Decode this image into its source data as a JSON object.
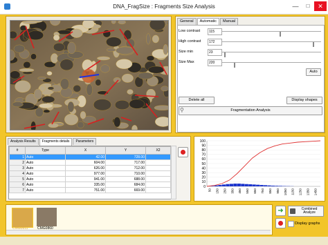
{
  "window": {
    "title": "DNA_FragSize : Fragments Size Analysis"
  },
  "controls": {
    "tabs": [
      "General",
      "Automatic",
      "Manual"
    ],
    "active_tab": "Automatic",
    "params": [
      {
        "label": "Low contrast",
        "value": "115",
        "fraction": 0.59
      },
      {
        "label": "High contrast",
        "value": "172",
        "fraction": 0.93
      },
      {
        "label": "Size min",
        "value": "23",
        "fraction": 0.02
      },
      {
        "label": "Size Max",
        "value": "220",
        "fraction": 0.12
      }
    ],
    "auto_label": "Auto",
    "delete_all_label": "Delete all",
    "display_shapes_label": "Display shapes",
    "fragmentation_label": "Fragmentation Analysis"
  },
  "results": {
    "tabs": [
      "Analysis Results",
      "Fragments details",
      "Parameters"
    ],
    "active_tab": "Fragments details",
    "columns": [
      "#",
      "Type",
      "X",
      "Y",
      "X2"
    ],
    "rows": [
      {
        "idx": "1",
        "type": "Auto",
        "x": "42.00",
        "y": "728.00",
        "selected": true
      },
      {
        "idx": "2",
        "type": "Auto",
        "x": "604.00",
        "y": "717.00",
        "selected": false
      },
      {
        "idx": "3",
        "type": "Auto",
        "x": "626.00",
        "y": "712.00",
        "selected": false
      },
      {
        "idx": "4",
        "type": "Auto",
        "x": "977.00",
        "y": "710.00",
        "selected": false
      },
      {
        "idx": "5",
        "type": "Auto",
        "x": "941.00",
        "y": "688.00",
        "selected": false
      },
      {
        "idx": "6",
        "type": "Auto",
        "x": "335.00",
        "y": "684.00",
        "selected": false
      },
      {
        "idx": "7",
        "type": "Auto",
        "x": "751.00",
        "y": "669.00",
        "selected": false
      }
    ]
  },
  "chart_data": {
    "type": "line",
    "y_ticks": [
      "100",
      "90",
      "80",
      "70",
      "60",
      "50",
      "40",
      "30",
      "20",
      "10",
      "0"
    ],
    "x_ticks": [
      "50",
      "150",
      "250",
      "350",
      "450",
      "550",
      "650",
      "750",
      "850",
      "950",
      "1050",
      "1150",
      "1250",
      "1350",
      "1450"
    ],
    "ylim": [
      0,
      100
    ],
    "xlim": [
      0,
      1500
    ],
    "series": [
      {
        "type": "line",
        "color": "#e03030",
        "x": [
          0,
          100,
          200,
          300,
          400,
          500,
          600,
          700,
          800,
          900,
          1000,
          1100,
          1200,
          1300,
          1400,
          1500
        ],
        "y": [
          0,
          2,
          6,
          14,
          28,
          45,
          62,
          74,
          83,
          89,
          93,
          95,
          97,
          98,
          99,
          100
        ]
      },
      {
        "type": "bar",
        "color": "#1a33cc",
        "x": [
          0,
          50,
          100,
          150,
          200,
          250,
          300,
          350,
          400,
          450,
          500,
          550,
          600,
          650,
          700,
          750,
          800,
          850,
          900,
          950,
          1000,
          1050,
          1100
        ],
        "y": [
          0.5,
          1,
          2,
          3,
          4,
          5,
          5.5,
          6,
          6,
          5.5,
          5,
          4.5,
          4,
          3.5,
          3,
          2.5,
          2,
          1.5,
          1.2,
          1,
          0.7,
          0.5,
          0.3
        ]
      }
    ]
  },
  "thumbnails": [
    {
      "caption": "CMG0811"
    },
    {
      "caption": "CMG0860"
    }
  ],
  "combined_analyze_label": "Combined Analyze",
  "display_graphs_label": "Display graphs"
}
